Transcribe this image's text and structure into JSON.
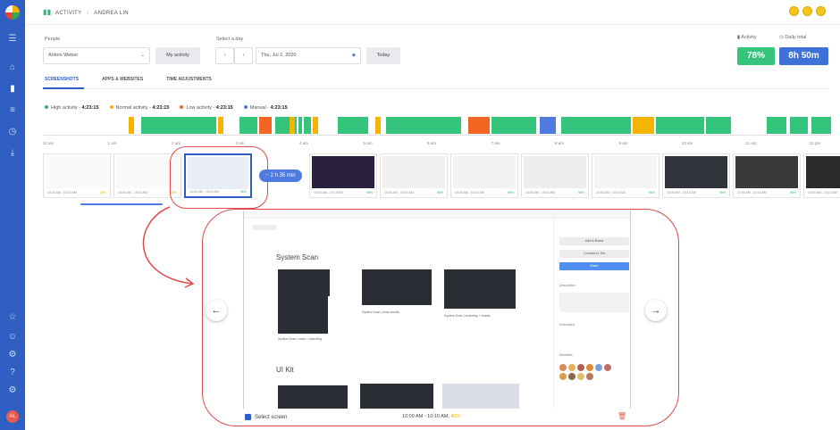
{
  "breadcrumb": {
    "section": "ACTIVITY",
    "user": "ANDREA LIN"
  },
  "filters": {
    "people_label": "People",
    "person": "Antoni Weber",
    "my_activity": "My activity",
    "day_label": "Select a day",
    "prev": "‹",
    "next": "›",
    "date": "Thu, Jul 2, 2020",
    "today": "Today"
  },
  "stats": {
    "activity_label": "Activity",
    "daily_total_label": "Daily total",
    "activity_value": "78%",
    "daily_total_value": "8h 50m",
    "activity_color": "#34c47c",
    "total_color": "#3f72d8"
  },
  "tabs": [
    "SCREENSHOTS",
    "APPS & WEBSITES",
    "TIME ADJUSTMENTS"
  ],
  "legend": [
    {
      "label": "High activity -",
      "value": "4:23:15",
      "color": "#2bb673"
    },
    {
      "label": "Normal activity -",
      "value": "4:23:15",
      "color": "#f4b400"
    },
    {
      "label": "Low activity -",
      "value": "4:23:15",
      "color": "#f26522"
    },
    {
      "label": "Manual -",
      "value": "4:23:15",
      "color": "#4f7be0"
    }
  ],
  "timeline_ticks": [
    "12 am",
    "1 am",
    "2 am",
    "3 am",
    "4 am",
    "5 am",
    "6 am",
    "7 am",
    "8 am",
    "9 am",
    "10 am",
    "11 am",
    "12 pm"
  ],
  "thumbnails": [
    {
      "time": "10:00 AM - 10:10 AM",
      "pct": "45%"
    },
    {
      "time": "10:00 AM - 10:10 AM",
      "pct": "45%"
    },
    {
      "time": "10:00 AM - 10:10 AM",
      "pct": "96%"
    },
    {
      "time": "10:00 AM - 10:10 AM",
      "pct": "96%"
    },
    {
      "time": "10:00 AM - 10:10 AM",
      "pct": "96%"
    },
    {
      "time": "10:00 AM - 10:10 AM",
      "pct": "96%"
    },
    {
      "time": "10:00 AM - 10:10 AM",
      "pct": "96%"
    },
    {
      "time": "10:00 AM - 10:10 AM",
      "pct": "96%"
    },
    {
      "time": "10:00 AM - 10:10 AM",
      "pct": "96%"
    },
    {
      "time": "10:00 AM - 10:10 AM",
      "pct": "96%"
    },
    {
      "time": "10:00 AM - 10:10 AM",
      "pct": "96%"
    }
  ],
  "gap_label": "+ 2 h 35 min",
  "viewer": {
    "section1": "System Scan",
    "section2": "UI Kit",
    "captions": [
      "System Scan | main + scanning",
      "System Scan | scan results",
      "System Scan | scanning + results"
    ],
    "panel_buttons": [
      "Add to Board",
      "Connect to Jira",
      "Share"
    ],
    "panel_labels": [
      "Description",
      "Extensions",
      "Members"
    ]
  },
  "footer": {
    "select_label": "Select screen",
    "range": "10:00 AM - 10:10 AM,",
    "range_pct": "45%"
  }
}
